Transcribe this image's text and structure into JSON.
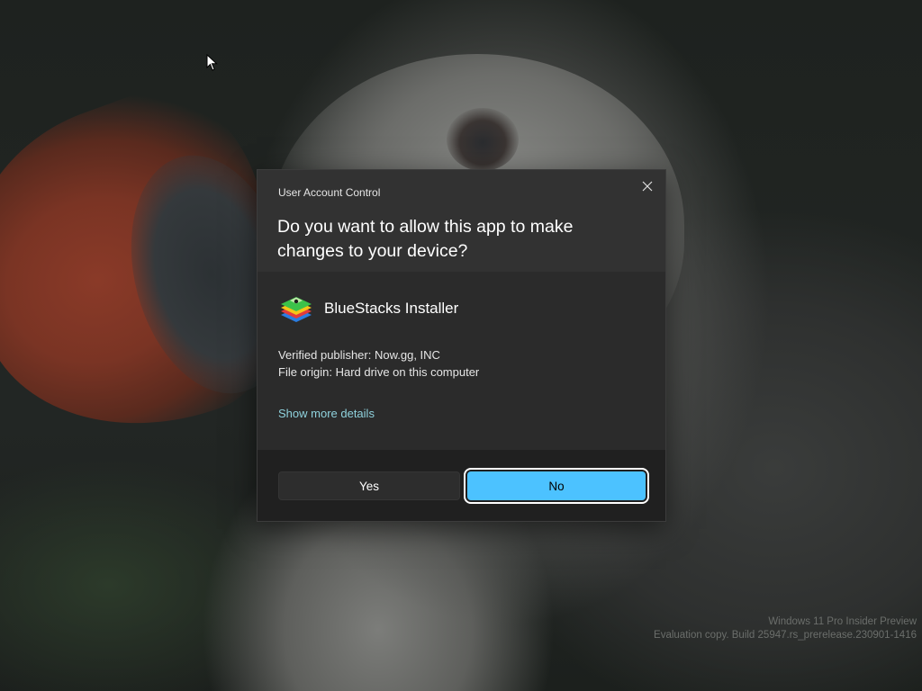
{
  "dialog": {
    "title": "User Account Control",
    "question": "Do you want to allow this app to make changes to your device?",
    "app_name": "BlueStacks Installer",
    "publisher": "Verified publisher: Now.gg, INC",
    "origin": "File origin: Hard drive on this computer",
    "details_link": "Show more details",
    "yes_label": "Yes",
    "no_label": "No",
    "close_icon": "close-icon",
    "app_icon": "bluestacks-icon",
    "accent_color": "#4cc2ff",
    "link_color": "#8fd2dd"
  },
  "watermark": {
    "line1": "Windows 11 Pro Insider Preview",
    "line2": "Evaluation copy. Build 25947.rs_prerelease.230901-1416"
  }
}
